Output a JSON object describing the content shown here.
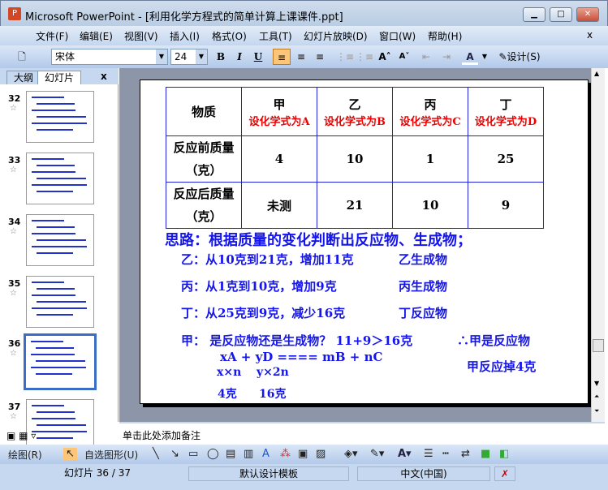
{
  "window": {
    "title": "Microsoft PowerPoint - [利用化学方程式的简单计算上课课件.ppt]",
    "minimize": "▁",
    "maximize": "□",
    "close": "✕"
  },
  "menu": [
    "文件(F)",
    "编辑(E)",
    "视图(V)",
    "插入(I)",
    "格式(O)",
    "工具(T)",
    "幻灯片放映(D)",
    "窗口(W)",
    "帮助(H)"
  ],
  "menu_close": "x",
  "toolbar": {
    "font": "宋体",
    "size": "24",
    "bold": "B",
    "italic": "I",
    "underline": "U",
    "design": "设计(S)",
    "font_color_label": "A"
  },
  "tabs": {
    "outline": "大纲",
    "slides": "幻灯片",
    "close": "x"
  },
  "thumbnails": [
    {
      "num": "32"
    },
    {
      "num": "33"
    },
    {
      "num": "34"
    },
    {
      "num": "35"
    },
    {
      "num": "36",
      "selected": true
    },
    {
      "num": "37"
    }
  ],
  "slide": {
    "table": {
      "header": [
        "物质",
        "甲",
        "乙",
        "丙",
        "丁"
      ],
      "sub": [
        "",
        "设化学式为A",
        "设化学式为B",
        "设化学式为C",
        "设化学式为D"
      ],
      "rows": [
        {
          "label1": "反应前质量",
          "label2": "（克）",
          "values": [
            "4",
            "10",
            "1",
            "25"
          ]
        },
        {
          "label1": "反应后质量",
          "label2": "（克）",
          "values": [
            "未测",
            "21",
            "10",
            "9"
          ]
        }
      ]
    },
    "heading": "思路：根据质量的变化判断出反应物、生成物；",
    "lines": [
      {
        "left": "乙：从10克到21克，增加11克",
        "right": "乙生成物"
      },
      {
        "left": "丙：从1克到10克，增加9克",
        "right": "丙生成物"
      },
      {
        "left": "丁：从25克到9克，减少16克",
        "right": "丁反应物"
      }
    ],
    "jia_line": "甲：  是反应物还是生成物？ 11+9＞16克",
    "conclusion": "∴甲是反应物",
    "equation": "xA  +  yD  ====  mB  +  nC",
    "ratio1": "x×n",
    "ratio2": "y×2n",
    "mass1": "4克",
    "mass2": "16克",
    "consumed": "甲反应掉4克"
  },
  "notes_placeholder": "单击此处添加备注",
  "drawbar": {
    "draw": "绘图(R)",
    "autoshape": "自选图形(U)"
  },
  "status": {
    "slide": "幻灯片 36 / 37",
    "template": "默认设计模板",
    "language": "中文(中国)"
  }
}
